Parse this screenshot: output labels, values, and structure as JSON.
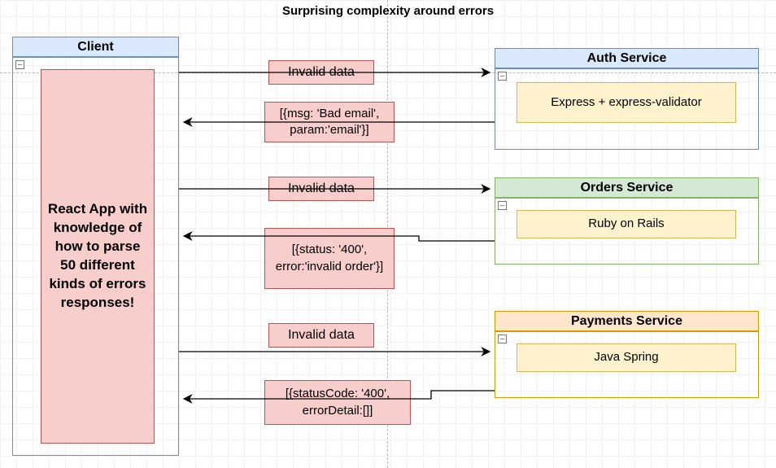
{
  "title": "Surprising complexity around errors",
  "client": {
    "header": "Client",
    "body": "React App with knowledge of how to parse 50 different kinds of errors responses!"
  },
  "services": {
    "auth": {
      "header": "Auth Service",
      "tech": "Express + express-validator"
    },
    "orders": {
      "header": "Orders Service",
      "tech": "Ruby on Rails"
    },
    "payments": {
      "header": "Payments Service",
      "tech": "Java Spring"
    }
  },
  "labels": {
    "invalid1": "Invalid data",
    "invalid2": "Invalid data",
    "invalid3": "Invalid data",
    "resp1": "[{msg: 'Bad email', param:'email'}]",
    "resp2": "[{status: '400', error:'invalid order'}]",
    "resp3": "[{statusCode: '400', errorDetail:[]]"
  },
  "collapse_glyph": "–"
}
